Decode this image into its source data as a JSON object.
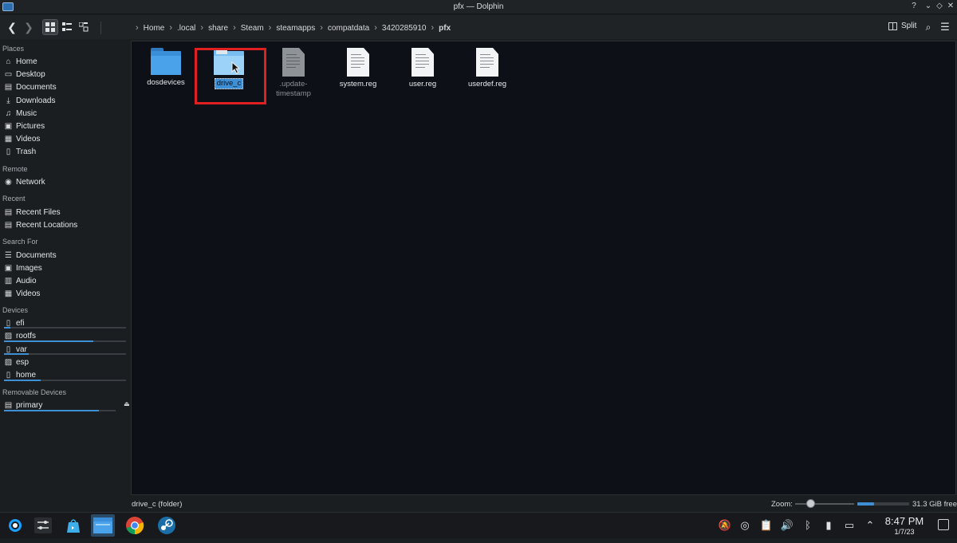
{
  "window": {
    "title": "pfx — Dolphin",
    "controls": [
      "?",
      "⌄",
      "◇",
      "✕"
    ]
  },
  "toolbar": {
    "breadcrumb": [
      "Home",
      ".local",
      "share",
      "Steam",
      "steamapps",
      "compatdata",
      "3420285910",
      "pfx"
    ],
    "split_label": "Split"
  },
  "sidebar": {
    "places_header": "Places",
    "places": [
      {
        "label": "Home",
        "icon": "home-icon"
      },
      {
        "label": "Desktop",
        "icon": "desktop-icon"
      },
      {
        "label": "Documents",
        "icon": "documents-icon"
      },
      {
        "label": "Downloads",
        "icon": "downloads-icon"
      },
      {
        "label": "Music",
        "icon": "music-icon"
      },
      {
        "label": "Pictures",
        "icon": "pictures-icon"
      },
      {
        "label": "Videos",
        "icon": "videos-icon"
      },
      {
        "label": "Trash",
        "icon": "trash-icon"
      }
    ],
    "remote_header": "Remote",
    "remote": [
      {
        "label": "Network",
        "icon": "network-icon"
      }
    ],
    "recent_header": "Recent",
    "recent": [
      {
        "label": "Recent Files",
        "icon": "recent-files-icon"
      },
      {
        "label": "Recent Locations",
        "icon": "recent-locations-icon"
      }
    ],
    "search_header": "Search For",
    "search": [
      {
        "label": "Documents",
        "icon": "documents-icon"
      },
      {
        "label": "Images",
        "icon": "images-icon"
      },
      {
        "label": "Audio",
        "icon": "audio-icon"
      },
      {
        "label": "Videos",
        "icon": "videos-icon"
      }
    ],
    "devices_header": "Devices",
    "devices": [
      {
        "label": "efi",
        "icon": "drive-icon",
        "usage": 0.05
      },
      {
        "label": "rootfs",
        "icon": "drive-locked-icon",
        "usage": 0.73
      },
      {
        "label": "var",
        "icon": "drive-icon",
        "usage": 0.2
      },
      {
        "label": "esp",
        "icon": "drive-locked-icon",
        "usage": 0
      },
      {
        "label": "home",
        "icon": "drive-icon",
        "usage": 0.3
      }
    ],
    "removable_header": "Removable Devices",
    "removable": [
      {
        "label": "primary",
        "icon": "sd-card-icon",
        "usage": 0.85
      }
    ]
  },
  "files": [
    {
      "name": "dosdevices",
      "type": "folder"
    },
    {
      "name": "drive_c",
      "type": "folder"
    },
    {
      "name": ".update-\ntimestamp",
      "type": "file-hidden"
    },
    {
      "name": "system.reg",
      "type": "file"
    },
    {
      "name": "user.reg",
      "type": "file"
    },
    {
      "name": "userdef.reg",
      "type": "file"
    }
  ],
  "status": {
    "selection": "drive_c (folder)",
    "zoom_label": "Zoom:",
    "zoom_level": 0.25,
    "free_space": "31.3 GiB free",
    "space_used": 0.33
  },
  "taskbar": {
    "time": "8:47 PM",
    "date": "1/7/23",
    "apps": [
      "steamos-icon",
      "settings-icon",
      "discover-icon",
      "dolphin-icon",
      "chrome-icon",
      "steam-icon"
    ],
    "tray": [
      "notifications-off-icon",
      "steam-tray-icon",
      "clipboard-icon",
      "volume-icon",
      "bluetooth-icon",
      "battery-icon",
      "display-icon",
      "expand-tray-icon"
    ]
  },
  "colors": {
    "accent": "#3d8fd6",
    "highlight_box": "#e02020"
  }
}
